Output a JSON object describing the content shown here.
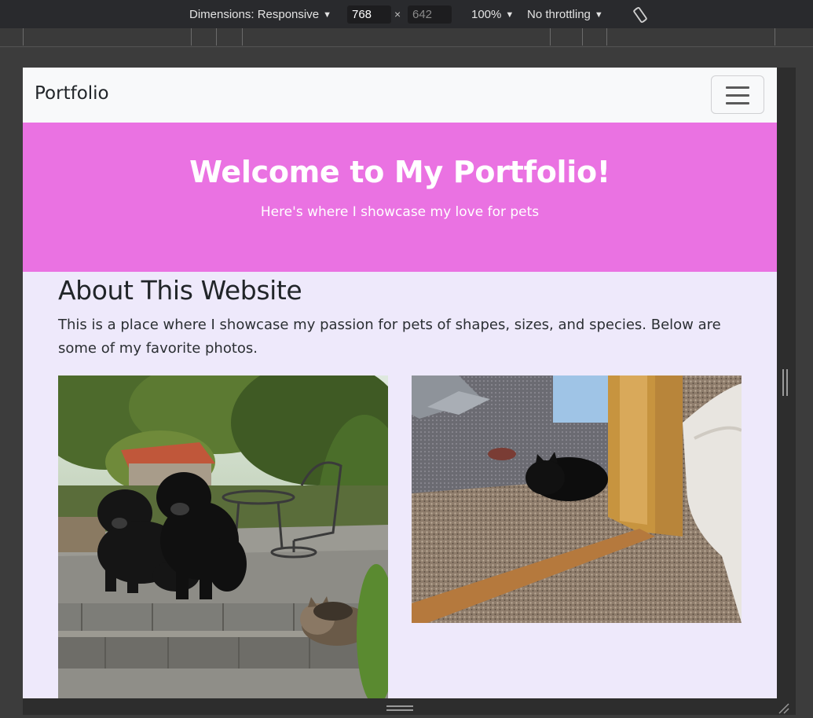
{
  "devtools": {
    "dimensions_label": "Dimensions: Responsive",
    "width_value": "768",
    "height_value": "642",
    "times_symbol": "×",
    "zoom_label": "100%",
    "throttling_label": "No throttling",
    "caret": "▼"
  },
  "navbar": {
    "brand": "Portfolio"
  },
  "hero": {
    "title": "Welcome to My Portfolio!",
    "subtitle": "Here's where I showcase my love for pets",
    "background": "#ea72e2"
  },
  "about": {
    "title": "About This Website",
    "text": "This is a place where I showcase my passion for pets of shapes, sizes, and species. Below are some of my favorite photos."
  },
  "colors": {
    "page_background": "#eee9fb",
    "navbar_background": "#f8f9fa",
    "devtools_background": "#292a2d"
  },
  "icons": {
    "rotate": "rotate-icon",
    "menu": "hamburger-menu-icon"
  }
}
